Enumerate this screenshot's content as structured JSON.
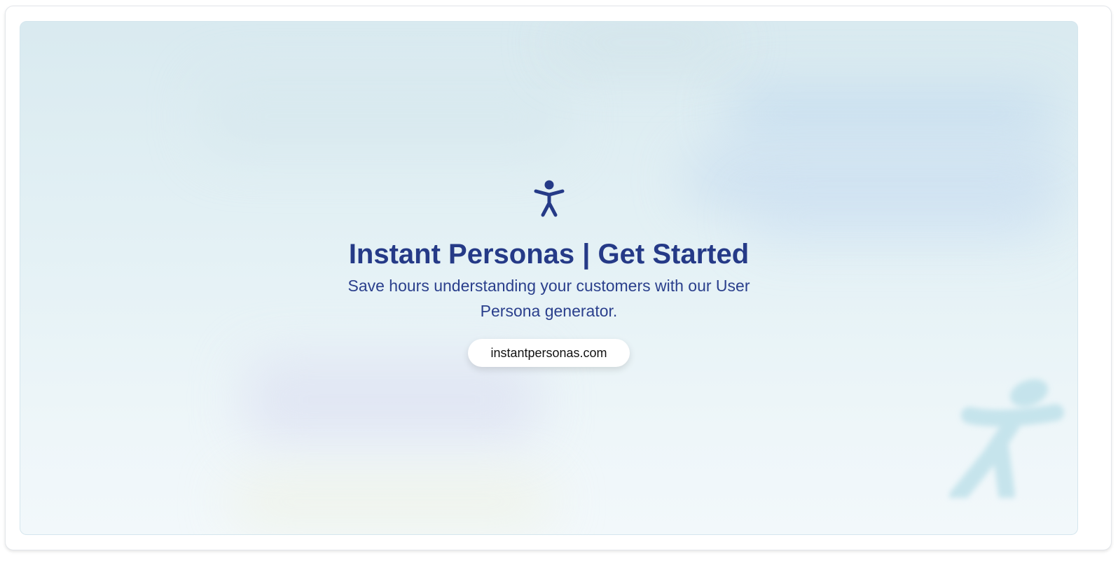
{
  "hero": {
    "title": "Instant Personas | Get Started",
    "subtitle": "Save hours understanding your customers with our User Persona generator.",
    "link_label": "instantpersonas.com",
    "icons": {
      "logo": "person-arms-out-icon",
      "watermark": "person-arms-out-icon"
    }
  },
  "colors": {
    "brand": "#253a87",
    "watermark": "#bfe1ea",
    "background_top": "#d9eaf0",
    "background_bottom": "#f2f8fb"
  }
}
